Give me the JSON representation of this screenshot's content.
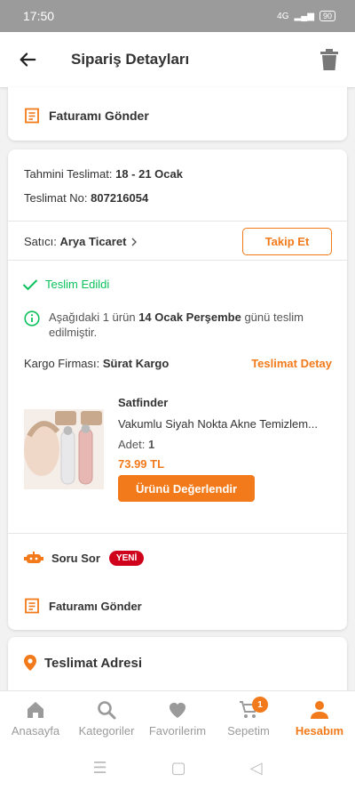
{
  "status": {
    "time": "17:50",
    "network": "4G",
    "battery": "90"
  },
  "header": {
    "title": "Sipariş Detayları"
  },
  "top_card": {
    "invoice_label": "Faturamı Gönder"
  },
  "order": {
    "est_delivery_label": "Tahmini Teslimat:",
    "est_delivery_value": "18 - 21 Ocak",
    "delivery_no_label": "Teslimat No:",
    "delivery_no_value": "807216054",
    "seller_label": "Satıcı:",
    "seller_value": "Arya Ticaret",
    "follow_button": "Takip Et",
    "delivered_status": "Teslim Edildi",
    "info_pre": "Aşağıdaki 1 ürün ",
    "info_bold": "14 Ocak Perşembe",
    "info_post": " günü teslim edilmiştir.",
    "cargo_label": "Kargo Firması:",
    "cargo_value": "Sürat Kargo",
    "delivery_detail_link": "Teslimat Detay",
    "product": {
      "brand": "Satfinder",
      "name": "Vakumlu Siyah Nokta Akne Temizlem...",
      "qty_label": "Adet:",
      "qty_value": "1",
      "price": "73.99 TL",
      "review_button": "Ürünü Değerlendir"
    },
    "ask_question": "Soru Sor",
    "new_badge": "YENİ",
    "invoice_label": "Faturamı Gönder"
  },
  "address_card": {
    "title": "Teslimat Adresi"
  },
  "bottom_nav": [
    {
      "label": "Anasayfa",
      "icon": "home-icon"
    },
    {
      "label": "Kategoriler",
      "icon": "search-icon"
    },
    {
      "label": "Favorilerim",
      "icon": "heart-icon"
    },
    {
      "label": "Sepetim",
      "icon": "cart-icon",
      "badge": "1"
    },
    {
      "label": "Hesabım",
      "icon": "user-icon",
      "active": true
    }
  ],
  "colors": {
    "accent": "#f27a1a",
    "success": "#0bc15c",
    "badge": "#d0021b"
  }
}
